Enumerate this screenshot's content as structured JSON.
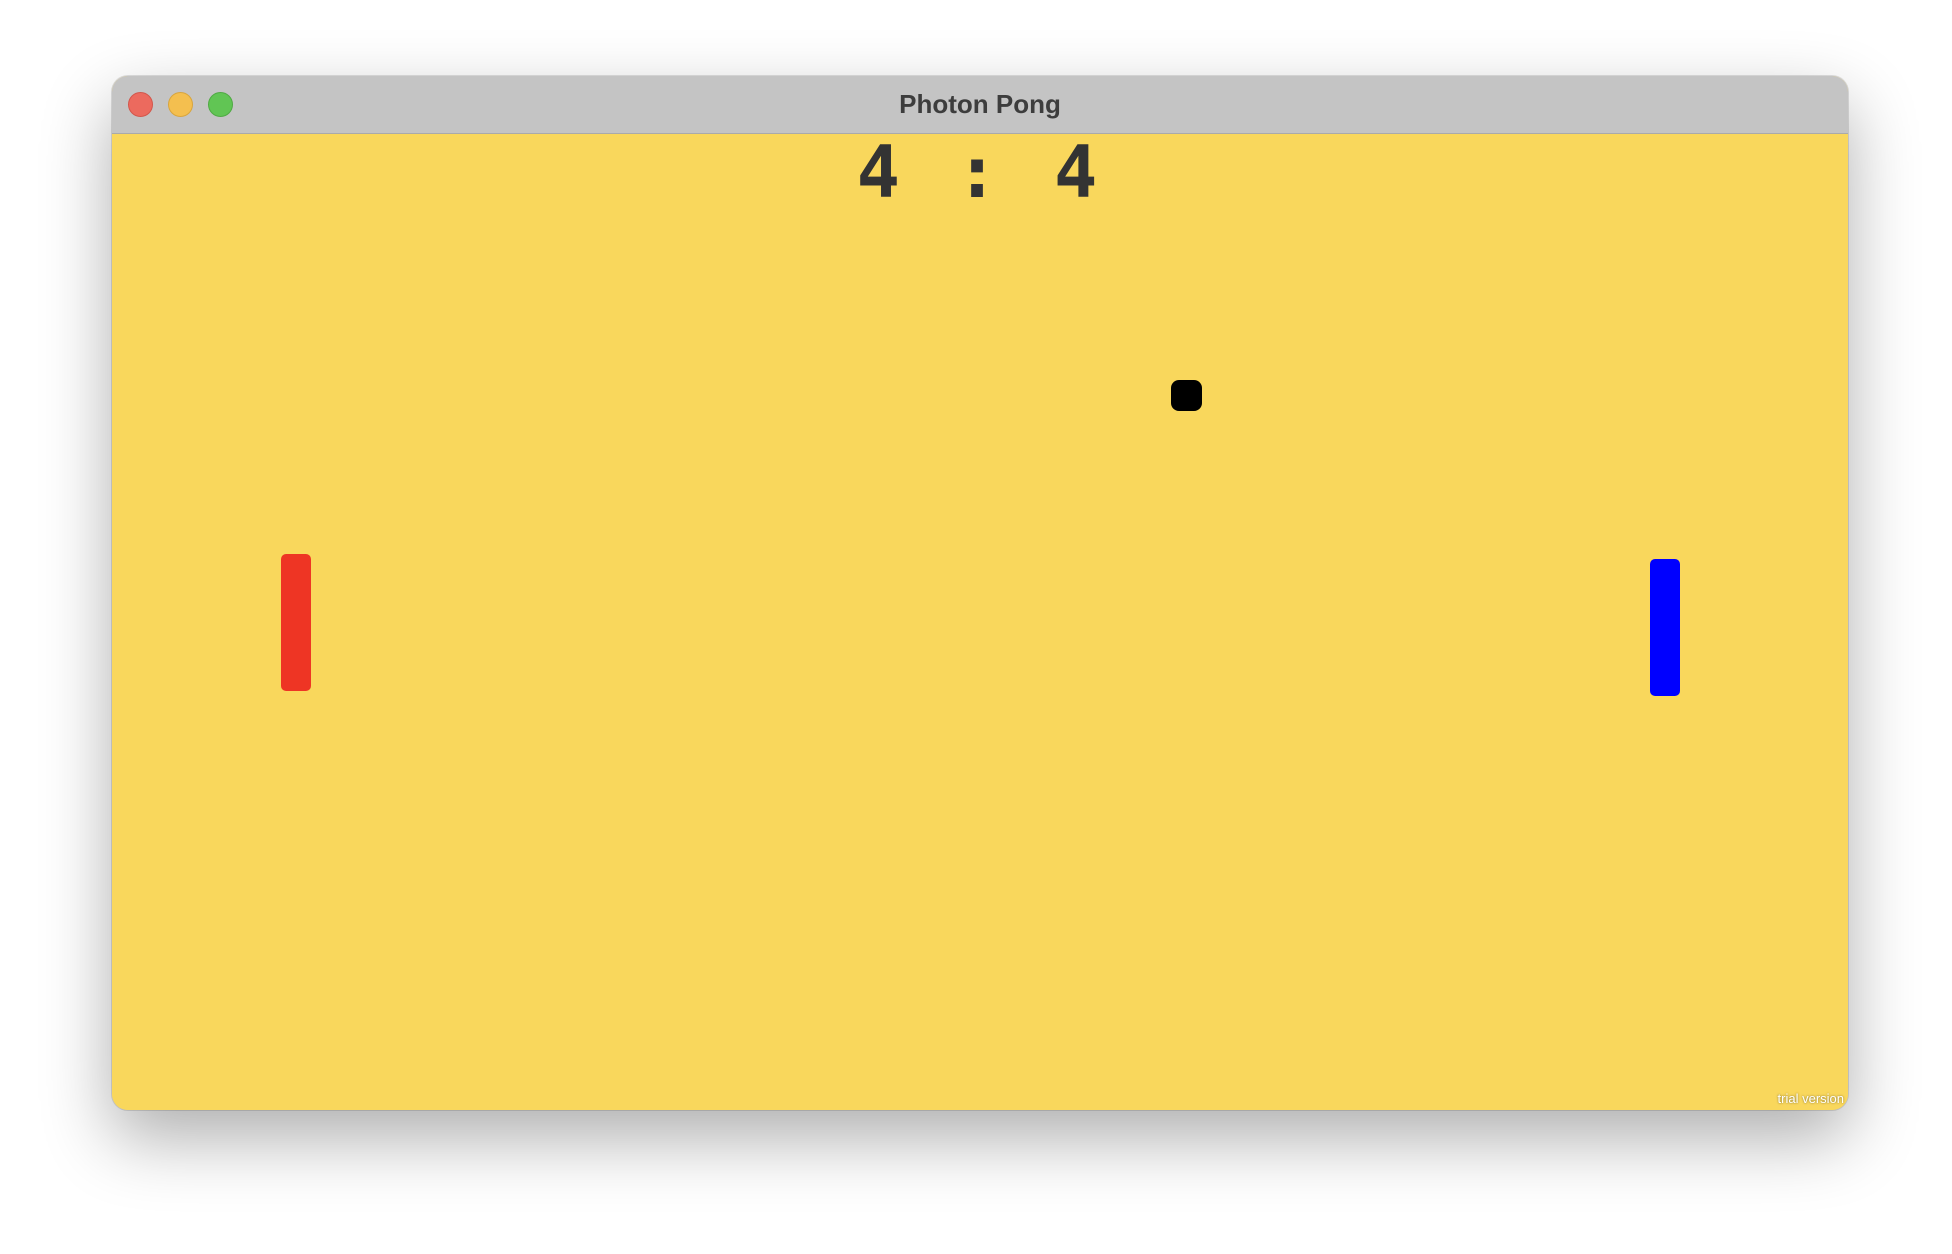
{
  "window": {
    "title": "Photon Pong"
  },
  "score": {
    "left": "4",
    "separator": ":",
    "right": "4"
  },
  "colors": {
    "court": "#f9d75c",
    "left_paddle": "#ee3524",
    "right_paddle": "#0000ff",
    "ball": "#000000"
  },
  "watermark": "trial version"
}
